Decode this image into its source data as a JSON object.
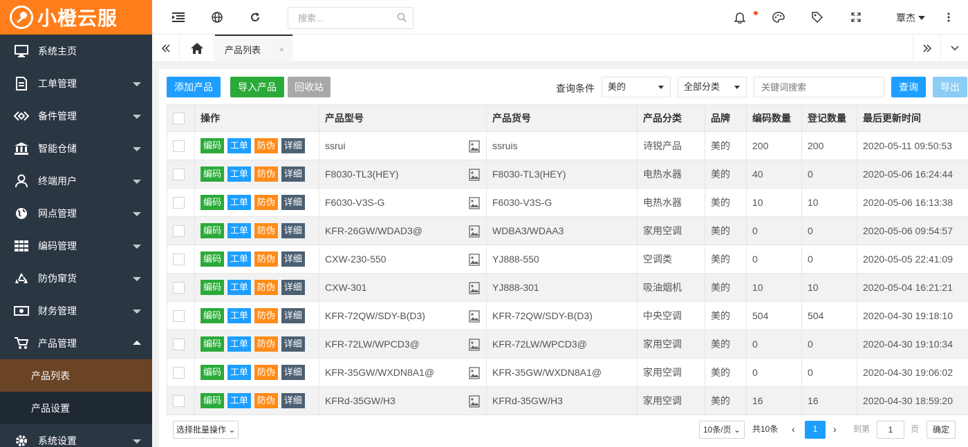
{
  "brand": {
    "name": "小橙云服"
  },
  "sidebar": {
    "items": [
      {
        "label": "系统主页",
        "icon": "monitor-icon"
      },
      {
        "label": "工单管理",
        "icon": "document-icon"
      },
      {
        "label": "备件管理",
        "icon": "diamond-icon"
      },
      {
        "label": "智能仓储",
        "icon": "bank-icon"
      },
      {
        "label": "终端用户",
        "icon": "user-icon"
      },
      {
        "label": "网点管理",
        "icon": "globe-icon"
      },
      {
        "label": "编码管理",
        "icon": "grid-icon"
      },
      {
        "label": "防伪窜货",
        "icon": "recycle-icon"
      },
      {
        "label": "财务管理",
        "icon": "money-icon"
      },
      {
        "label": "产品管理",
        "icon": "cart-icon"
      },
      {
        "label": "系统设置",
        "icon": "gear-icon"
      }
    ],
    "sub_items": [
      {
        "label": "产品列表"
      },
      {
        "label": "产品设置"
      }
    ]
  },
  "topbar": {
    "search_placeholder": "搜索...",
    "user_name": "覃杰"
  },
  "tabs": {
    "active_label": "产品列表",
    "close_symbol": "×"
  },
  "toolbar": {
    "add_label": "添加产品",
    "import_label": "导入产品",
    "recycle_label": "回收站",
    "filter_label": "查询条件",
    "brand_select": "美的",
    "category_select": "全部分类",
    "keyword_placeholder": "关键词搜索",
    "query_label": "查询",
    "export_label": "导出"
  },
  "table": {
    "headers": [
      "操作",
      "产品型号",
      "产品货号",
      "产品分类",
      "品牌",
      "编码数量",
      "登记数量",
      "最后更新时间"
    ],
    "op_labels": {
      "code": "编码",
      "order": "工单",
      "anti": "防伪",
      "detail": "详细"
    },
    "rows": [
      {
        "model": "ssrui",
        "sku": "ssruis",
        "category": "诗锐产品",
        "brand": "美的",
        "code_count": "200",
        "reg_count": "200",
        "updated": "2020-05-11 09:50:53"
      },
      {
        "model": "F8030-TL3(HEY)",
        "sku": "F8030-TL3(HEY)",
        "category": "电热水器",
        "brand": "美的",
        "code_count": "40",
        "reg_count": "0",
        "updated": "2020-05-06 16:24:44"
      },
      {
        "model": "F6030-V3S-G",
        "sku": "F6030-V3S-G",
        "category": "电热水器",
        "brand": "美的",
        "code_count": "10",
        "reg_count": "10",
        "updated": "2020-05-06 16:13:38"
      },
      {
        "model": "KFR-26GW/WDAD3@",
        "sku": "WDBA3/WDAA3",
        "category": "家用空调",
        "brand": "美的",
        "code_count": "0",
        "reg_count": "0",
        "updated": "2020-05-06 09:54:57"
      },
      {
        "model": "CXW-230-550",
        "sku": "YJ888-550",
        "category": "空调类",
        "brand": "美的",
        "code_count": "0",
        "reg_count": "0",
        "updated": "2020-05-05 22:41:09"
      },
      {
        "model": "CXW-301",
        "sku": "YJ888-301",
        "category": "吸油烟机",
        "brand": "美的",
        "code_count": "10",
        "reg_count": "10",
        "updated": "2020-05-04 16:21:21"
      },
      {
        "model": "KFR-72QW/SDY-B(D3)",
        "sku": "KFR-72QW/SDY-B(D3)",
        "category": "中央空调",
        "brand": "美的",
        "code_count": "504",
        "reg_count": "504",
        "updated": "2020-04-30 19:18:10"
      },
      {
        "model": "KFR-72LW/WPCD3@",
        "sku": "KFR-72LW/WPCD3@",
        "category": "家用空调",
        "brand": "美的",
        "code_count": "0",
        "reg_count": "0",
        "updated": "2020-04-30 19:10:34"
      },
      {
        "model": "KFR-35GW/WXDN8A1@",
        "sku": "KFR-35GW/WXDN8A1@",
        "category": "家用空调",
        "brand": "美的",
        "code_count": "0",
        "reg_count": "0",
        "updated": "2020-04-30 19:06:02"
      },
      {
        "model": "KFRd-35GW/H3",
        "sku": "KFRd-35GW/H3",
        "category": "家用空调",
        "brand": "美的",
        "code_count": "16",
        "reg_count": "16",
        "updated": "2020-04-30 18:59:20"
      }
    ]
  },
  "footer": {
    "batch_label": "选择批量操作",
    "page_size": "10条/页",
    "total": "共10条",
    "current_page": "1",
    "goto_label": "到第",
    "goto_value": "1",
    "page_unit": "页",
    "confirm_label": "确定"
  },
  "colors": {
    "brand_orange": "#ff7d1a",
    "sidebar_bg": "#2b3643",
    "primary_blue": "#1e9fff",
    "green": "#2baa3a",
    "orange": "#ff8c1a",
    "slate": "#4d6072"
  }
}
